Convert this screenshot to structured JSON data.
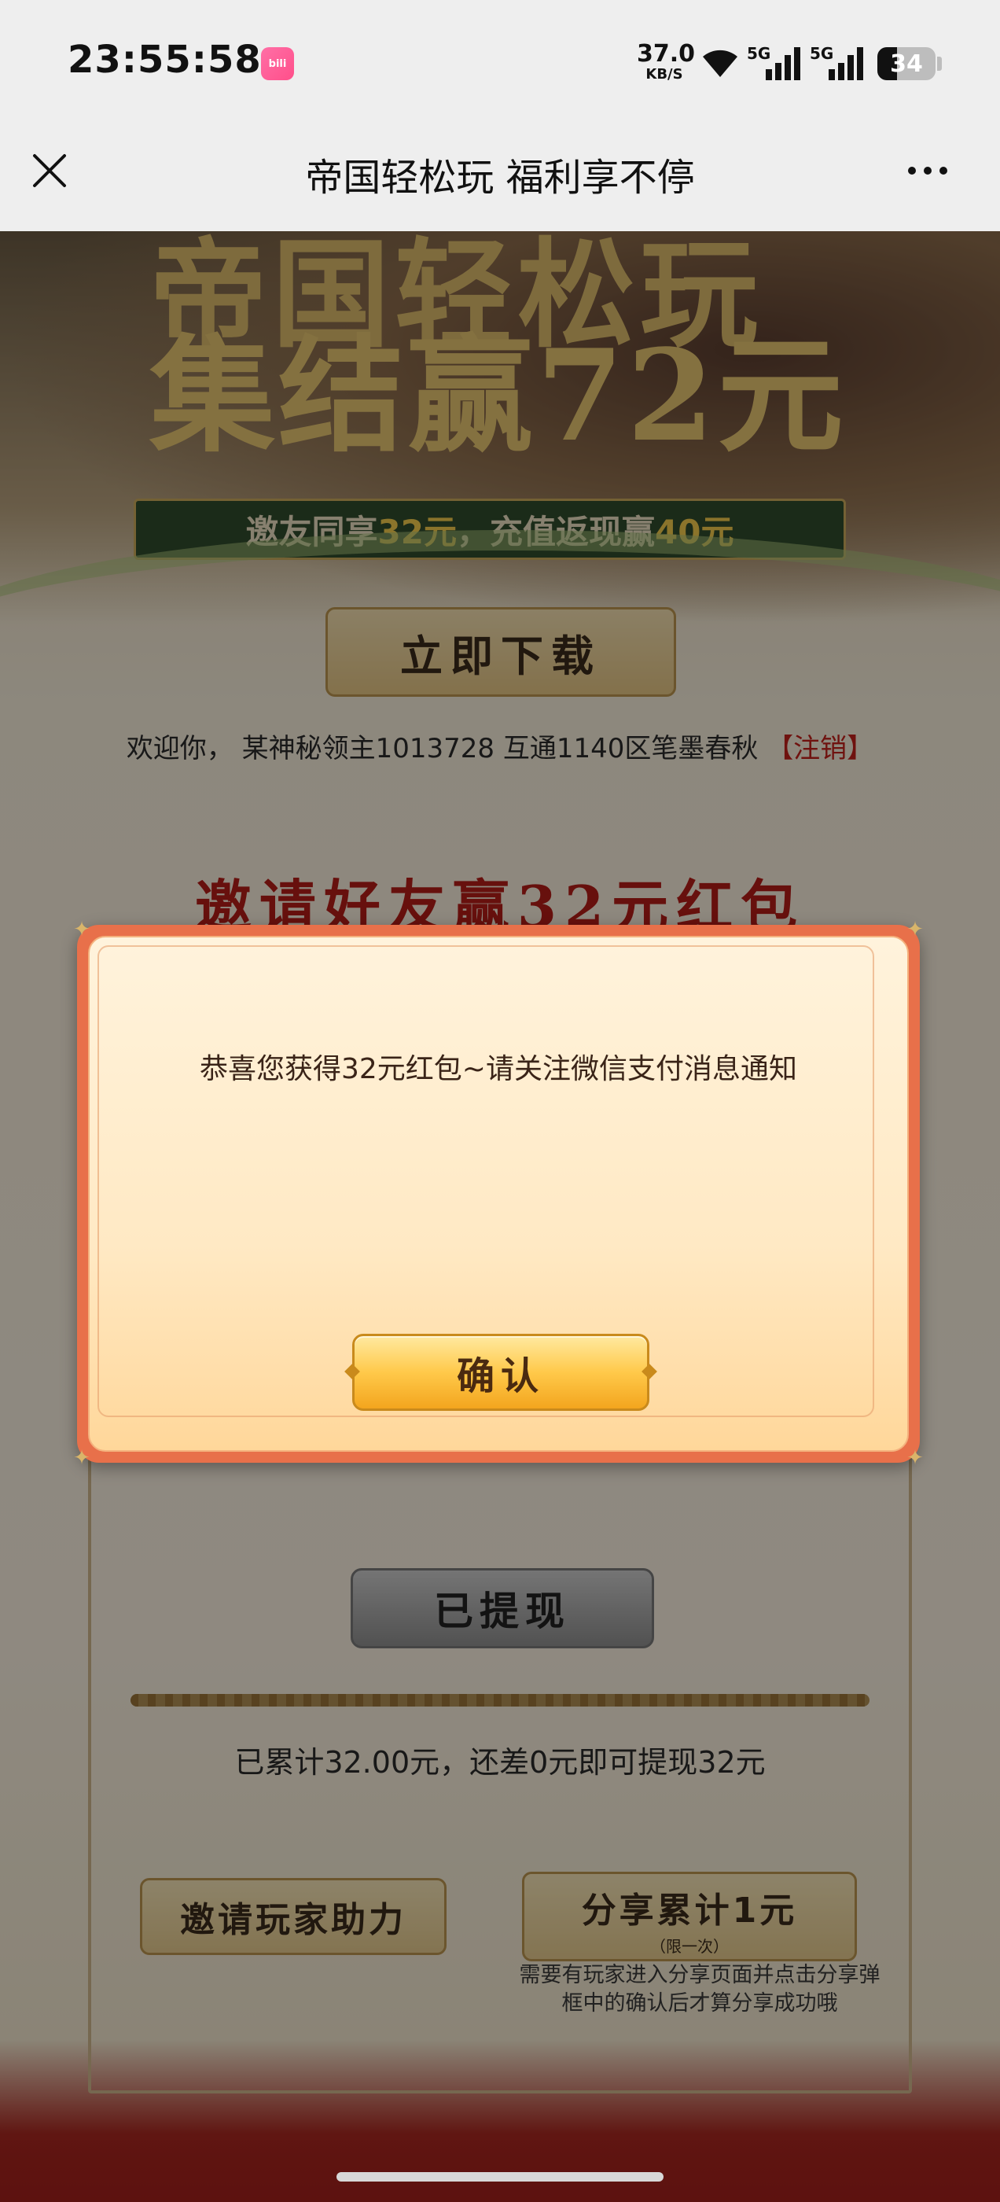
{
  "status_bar": {
    "time": "23:55:58",
    "app_icon": "bilibili-app-icon",
    "net_speed_value": "37.0",
    "net_speed_unit": "KB/S",
    "wifi_icon": "wifi-icon",
    "signal_1_label": "5G",
    "signal_2_label": "5G",
    "battery_level": "34",
    "battery_fraction": 0.34
  },
  "title_bar": {
    "close_icon": "close-icon",
    "title": "帝国轻松玩 福利享不停",
    "more_icon": "more-dots-icon"
  },
  "page": {
    "hero_title_line1": "帝国轻松玩",
    "hero_title_line2": "集结赢72元",
    "hero_ribbon_a": "邀友同享",
    "hero_ribbon_b": "32元",
    "hero_ribbon_c": "，充值返现赢",
    "hero_ribbon_d": "40元",
    "download_button": "立即下载",
    "welcome_text": "欢迎你， 某神秘领主1013728 互通1140区笔墨春秋 ",
    "logout_link": "【注销】",
    "invite_heading": "邀请好友赢32元红包",
    "withdrawn_button": "已提现",
    "progress_fraction": 1.0,
    "progress_text": "已累计32.00元，还差0元即可提现32元",
    "invite_help_button": "邀请玩家助力",
    "share_button": "分享累计1元",
    "share_button_sub": "（限一次）",
    "share_note": "需要有玩家进入分享页面并点击分享弹框中的确认后才算分享成功哦"
  },
  "modal": {
    "message": "恭喜您获得32元红包~请关注微信支付消息通知",
    "confirm_button": "确认"
  }
}
